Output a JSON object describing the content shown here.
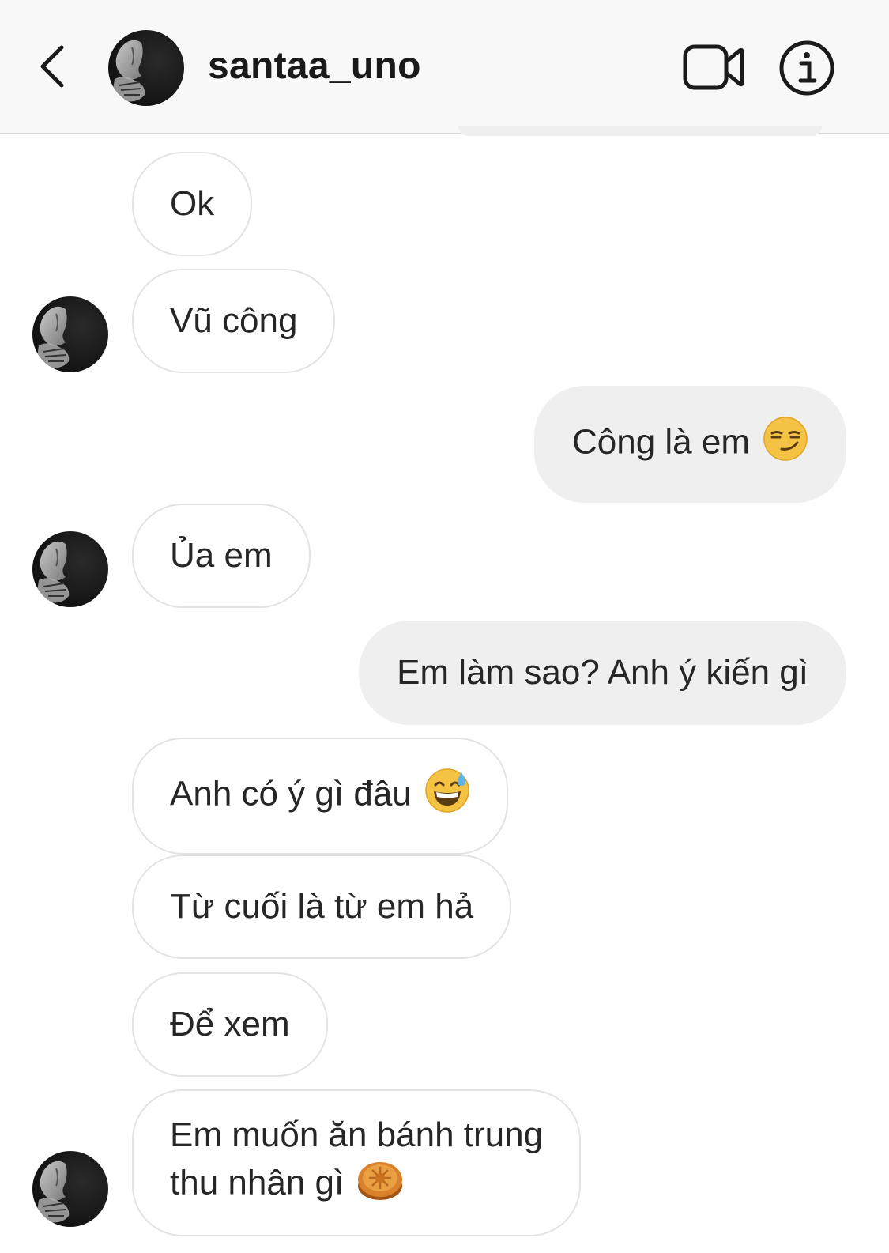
{
  "header": {
    "username": "santaa_uno",
    "back_icon": "chevron-left-icon",
    "video_icon": "video-camera-icon",
    "info_icon": "info-icon"
  },
  "messages": [
    {
      "direction": "in",
      "text": "Ok"
    },
    {
      "direction": "in",
      "text": "Vũ công"
    },
    {
      "direction": "out",
      "text": "Công là em",
      "emoji": "smirking-face"
    },
    {
      "direction": "in",
      "text": "Ủa em"
    },
    {
      "direction": "out",
      "text": "Em làm sao? Anh ý kiến gì"
    },
    {
      "direction": "in",
      "text": "Anh có ý gì đâu",
      "emoji": "grinning-face-with-sweat"
    },
    {
      "direction": "in",
      "text": "Từ cuối là từ em hả"
    },
    {
      "direction": "in",
      "text": "Để xem"
    },
    {
      "direction": "in",
      "text_line1": "Em muốn ăn bánh trung",
      "text_line2": "thu nhân gì",
      "emoji": "moon-cake"
    }
  ],
  "colors": {
    "header_bg": "#f8f8f8",
    "incoming_border": "#e3e3e3",
    "outgoing_bg": "#efefef",
    "text": "#262626"
  }
}
